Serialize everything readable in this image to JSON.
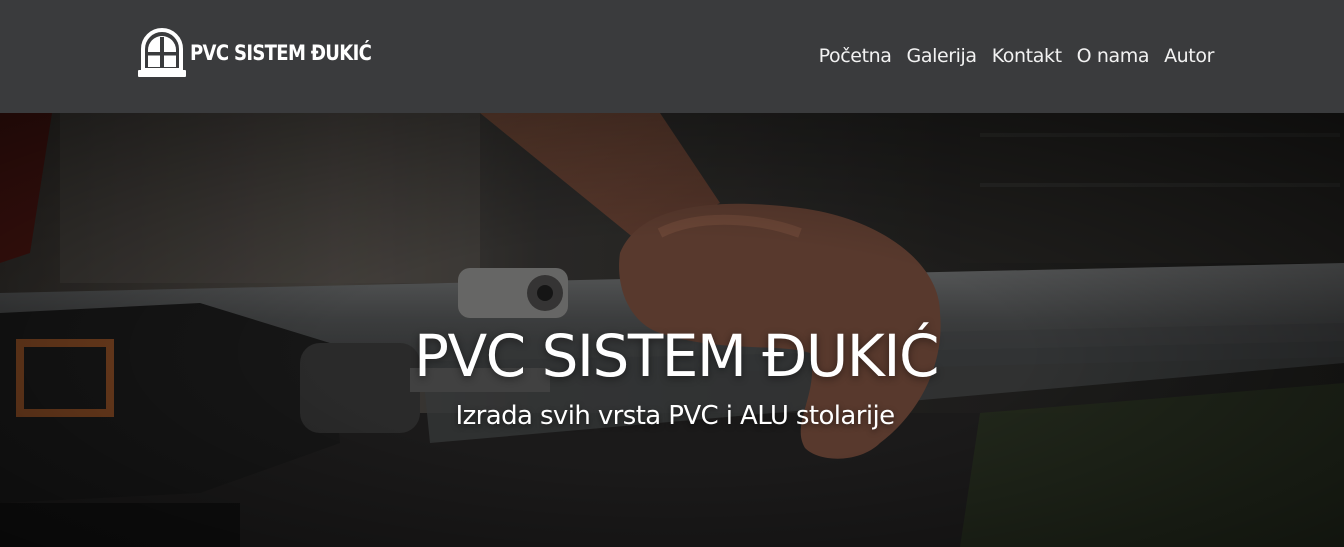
{
  "brand": {
    "name": "PVC SISTEM ĐUKIĆ",
    "logo_icon": "arched-window-icon"
  },
  "nav": {
    "items": [
      {
        "label": "Početna"
      },
      {
        "label": "Galerija"
      },
      {
        "label": "Kontakt"
      },
      {
        "label": "O nama"
      },
      {
        "label": "Autor"
      }
    ]
  },
  "hero": {
    "title": "PVC SISTEM ĐUKIĆ",
    "subtitle": "Izrada svih vrsta PVC i ALU stolarije"
  },
  "colors": {
    "navbar_bg": "#3a3b3d",
    "text": "#ffffff"
  }
}
